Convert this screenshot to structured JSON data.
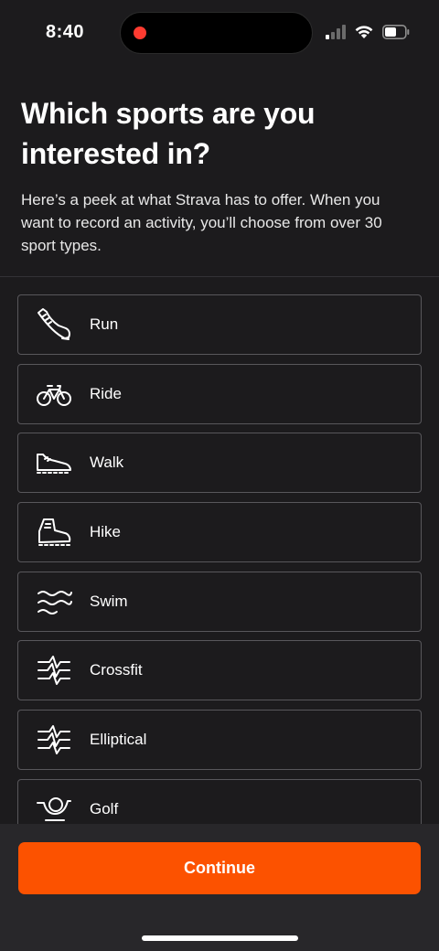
{
  "status_bar": {
    "time": "8:40",
    "icons": [
      "signal-icon",
      "wifi-icon",
      "battery-icon"
    ]
  },
  "header": {
    "title": "Which sports are you interested in?",
    "subtitle": "Here’s a peek at what Strava has to offer. When you want to record an activity, you’ll choose from over 30 sport types."
  },
  "sports": [
    {
      "label": "Run",
      "icon": "running-shoe-icon"
    },
    {
      "label": "Ride",
      "icon": "bicycle-icon"
    },
    {
      "label": "Walk",
      "icon": "walking-shoe-icon"
    },
    {
      "label": "Hike",
      "icon": "hiking-boot-icon"
    },
    {
      "label": "Swim",
      "icon": "waves-icon"
    },
    {
      "label": "Crossfit",
      "icon": "crossfit-icon"
    },
    {
      "label": "Elliptical",
      "icon": "elliptical-icon"
    },
    {
      "label": "Golf",
      "icon": "golf-icon"
    }
  ],
  "footer": {
    "continue_label": "Continue"
  },
  "colors": {
    "background": "#1c1b1d",
    "accent": "#fc5200",
    "border": "#58575b",
    "recording_dot": "#ff3b30"
  }
}
